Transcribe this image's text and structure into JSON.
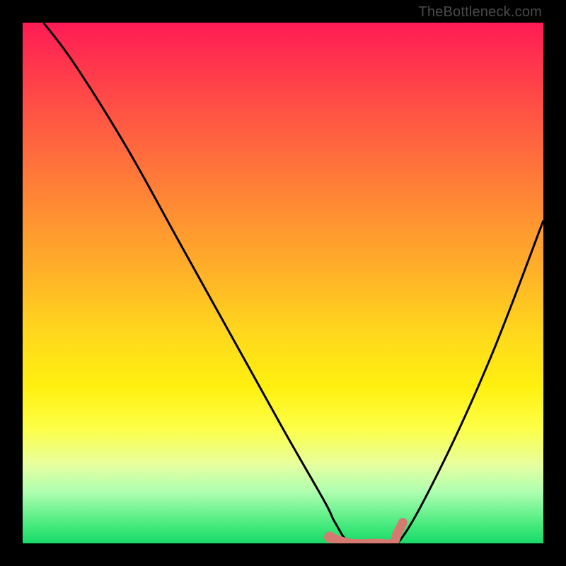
{
  "attribution": "TheBottleneck.com",
  "chart_data": {
    "type": "line",
    "title": "",
    "xlabel": "",
    "ylabel": "",
    "xlim": [
      0,
      100
    ],
    "ylim": [
      0,
      100
    ],
    "series": [
      {
        "name": "bottleneck-curve",
        "x": [
          4,
          10,
          20,
          30,
          40,
          50,
          58,
          60,
          63,
          68,
          72,
          80,
          90,
          100
        ],
        "values": [
          100,
          92,
          76,
          58,
          40,
          22,
          8,
          4,
          0,
          0,
          0,
          14,
          36,
          62
        ]
      }
    ],
    "highlight_segment": {
      "name": "optimal-range",
      "x": [
        59,
        63,
        68,
        71,
        72,
        73
      ],
      "values": [
        1.2,
        0,
        0,
        0,
        2,
        4
      ]
    },
    "highlight_point": {
      "x": 59,
      "y": 1.2
    }
  },
  "colors": {
    "curve": "#000000",
    "highlight": "#d57a70",
    "gradient_top": "#ff1b55",
    "gradient_bottom": "#17d968"
  }
}
